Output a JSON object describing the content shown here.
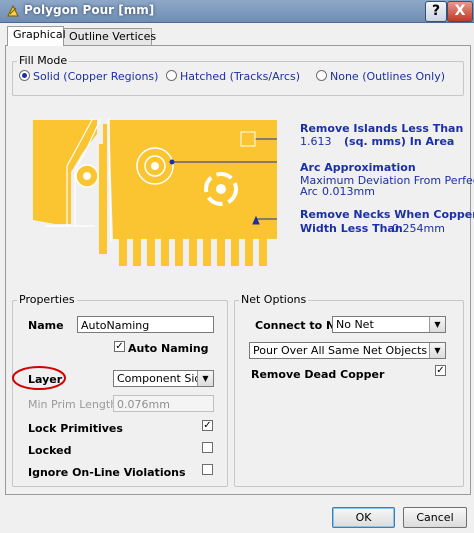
{
  "window": {
    "title": "Polygon Pour [mm]",
    "help_glyph": "?",
    "close_glyph": "X"
  },
  "tabs": [
    {
      "label": "Graphical",
      "active": true
    },
    {
      "label": "Outline Vertices",
      "active": false
    }
  ],
  "fill_mode": {
    "label": "Fill Mode",
    "options": [
      {
        "label": "Solid (Copper Regions)",
        "selected": true
      },
      {
        "label": "Hatched (Tracks/Arcs)",
        "selected": false
      },
      {
        "label": "None (Outlines Only)",
        "selected": false
      }
    ]
  },
  "diagram": {
    "copper_color": "#fbc531",
    "remove_islands": {
      "title": "Remove Islands Less Than",
      "value": "1.613",
      "unit": "(sq. mms) In Area"
    },
    "arc_approx": {
      "title": "Arc Approximation",
      "desc_line1": "Maximum Deviation From Perfect",
      "desc_line2": "Arc",
      "value": "0.013mm"
    },
    "remove_necks": {
      "title_line1": "Remove Necks When Copper",
      "title_line2": "Width Less Than",
      "value": "0.254mm"
    }
  },
  "properties": {
    "label": "Properties",
    "name_label": "Name",
    "name_value": "AutoNaming",
    "auto_naming_label": "Auto Naming",
    "auto_naming_checked": true,
    "layer_label": "Layer",
    "layer_value": "Component Side",
    "min_prim_label": "Min Prim Length",
    "min_prim_value": "0.076mm",
    "lock_primitives_label": "Lock Primitives",
    "lock_primitives_checked": true,
    "locked_label": "Locked",
    "locked_checked": false,
    "ignore_violations_label": "Ignore On-Line Violations",
    "ignore_violations_checked": false
  },
  "net_options": {
    "label": "Net Options",
    "connect_label": "Connect to Net",
    "connect_value": "No Net",
    "pour_mode_value": "Pour Over All Same Net Objects",
    "remove_dead_label": "Remove Dead Copper",
    "remove_dead_checked": true
  },
  "buttons": {
    "ok": "OK",
    "cancel": "Cancel"
  },
  "check_glyph": "✓",
  "dropdown_glyph": "▼"
}
